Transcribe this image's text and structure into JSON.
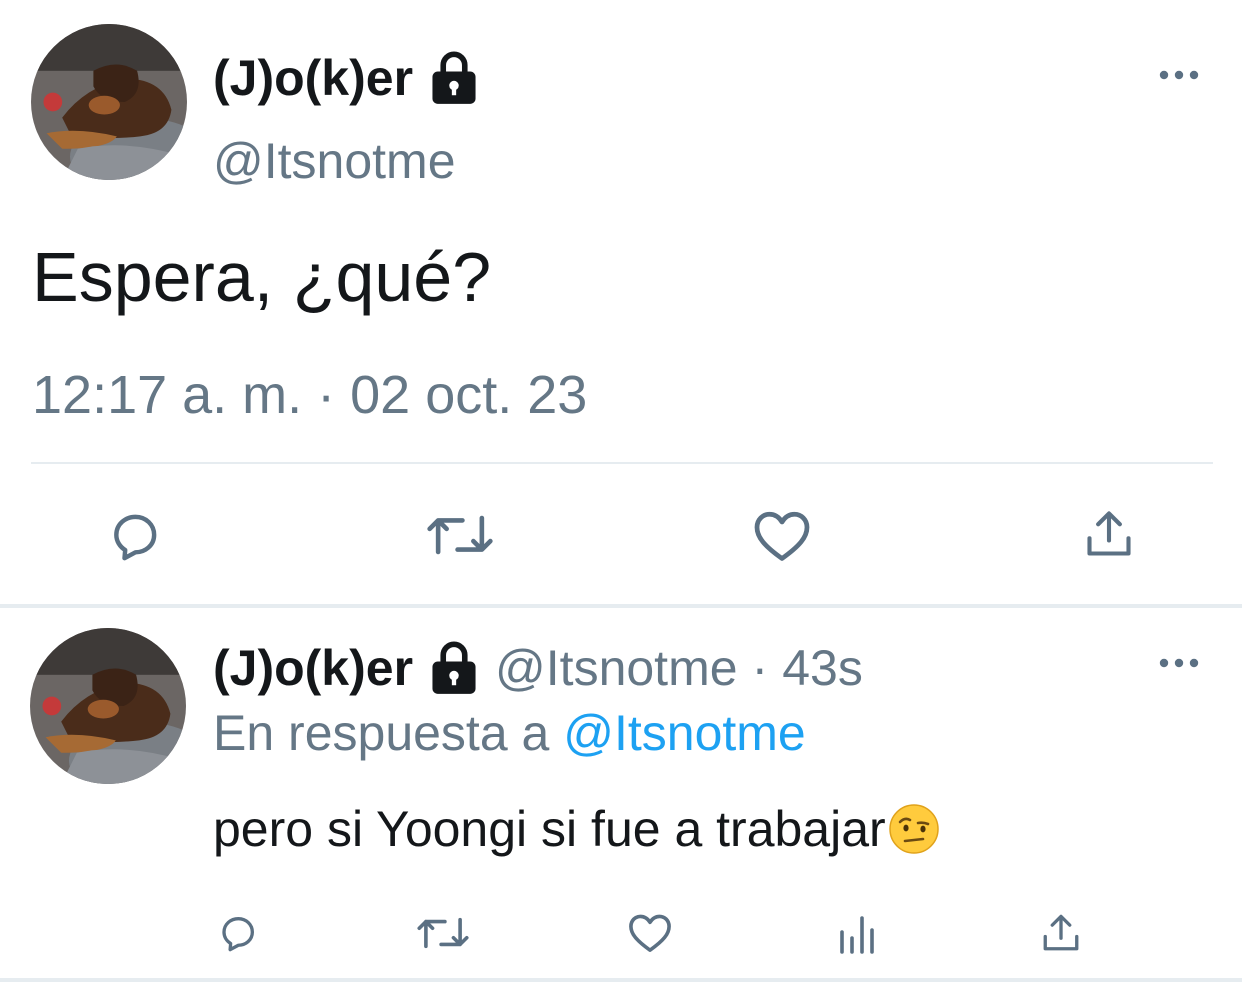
{
  "main_tweet": {
    "display_name": "(J)o(k)er",
    "handle": "@Itsnotme",
    "text": "Espera, ¿qué?",
    "timestamp": "12:17 a. m. · 02 oct. 23",
    "icons": [
      "lock-icon",
      "more-icon",
      "reply-icon",
      "retweet-icon",
      "like-icon",
      "share-icon"
    ]
  },
  "reply_tweet": {
    "display_name": "(J)o(k)er",
    "handle": "@Itsnotme",
    "separator": "·",
    "time": "43s",
    "context_prefix": "En respuesta a",
    "context_mention": "@Itsnotme",
    "text": "pero si Yoongi si fue a trabajar",
    "emoji": "face-with-raised-eyebrow",
    "icons": [
      "lock-icon",
      "more-icon",
      "reply-icon",
      "retweet-icon",
      "like-icon",
      "stats-icon",
      "share-icon"
    ]
  },
  "colors": {
    "text_primary": "#14171a",
    "text_secondary": "#657786",
    "link": "#1da1f2",
    "icon": "#5b7083",
    "divider": "#e6ecf0"
  }
}
